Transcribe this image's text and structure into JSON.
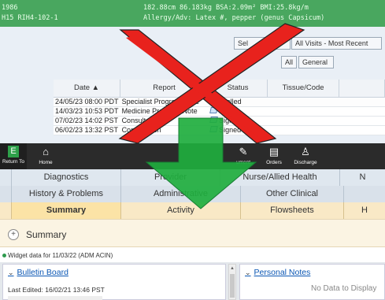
{
  "banner": {
    "line1_left": "1986",
    "line2_left": "H15 RIH4-102-1",
    "line1_right": "182.88cm  86.183kg  BSA:2.09m² BMI:25.8kg/m",
    "line2_right": "Allergy/Adv: Latex #, pepper (genus Capsicum)"
  },
  "visits": {
    "selected_label": "Sel",
    "all_visits_label": "All Visits - Most Recent",
    "all_label": "All",
    "general_label": "General",
    "columns": [
      "Date ▲",
      "Report",
      "Status",
      "Tissue/Code"
    ],
    "rows": [
      {
        "date": "24/05/23 08:00 PDT",
        "report": "Specialist Progress Note",
        "status": "Cancelled",
        "tissue": ""
      },
      {
        "date": "14/03/23 10:53 PDT",
        "report": "Medicine Progress Note",
        "status": "Draft",
        "tissue": ""
      },
      {
        "date": "07/02/23 14:02 PST",
        "report": "Consultation",
        "status": "Signed",
        "tissue": ""
      },
      {
        "date": "06/02/23 13:32 PST",
        "report": "Consultation",
        "status": "Signed",
        "tissue": ""
      }
    ]
  },
  "toolbar": {
    "return_label": "Return To",
    "return_glyph": "E",
    "home_label": "Home",
    "document_label": "ument",
    "orders_label": "Orders",
    "discharge_label": "Discharge"
  },
  "tabs": {
    "row1": [
      "Diagnostics",
      "Provider",
      "Nurse/Allied Health",
      "N"
    ],
    "row2": [
      "History & Problems",
      "Administrative",
      "Other Clinical"
    ],
    "row3": [
      "Summary",
      "Activity",
      "Flowsheets",
      "H"
    ],
    "active": "Summary"
  },
  "summary": {
    "toggle": "+",
    "title": "Summary",
    "widget_info": "Widget data for 11/03/22 (ADM ACIN)"
  },
  "panels": {
    "bulletin_title": "Bulletin Board",
    "bulletin_edited": "Last Edited: 16/02/21 13:46 PST",
    "notes_title": "Personal Notes",
    "notes_empty": "No Data to Display"
  },
  "colors": {
    "banner_bg": "#49a75f",
    "red_x": "#e8221d",
    "green_arrow": "#1fae3e",
    "active_tab": "#fbe3a6"
  },
  "icons": [
    "return-to-icon",
    "home-icon",
    "document-icon",
    "orders-icon",
    "discharge-icon",
    "expand-icon",
    "chevron-down-icon"
  ]
}
